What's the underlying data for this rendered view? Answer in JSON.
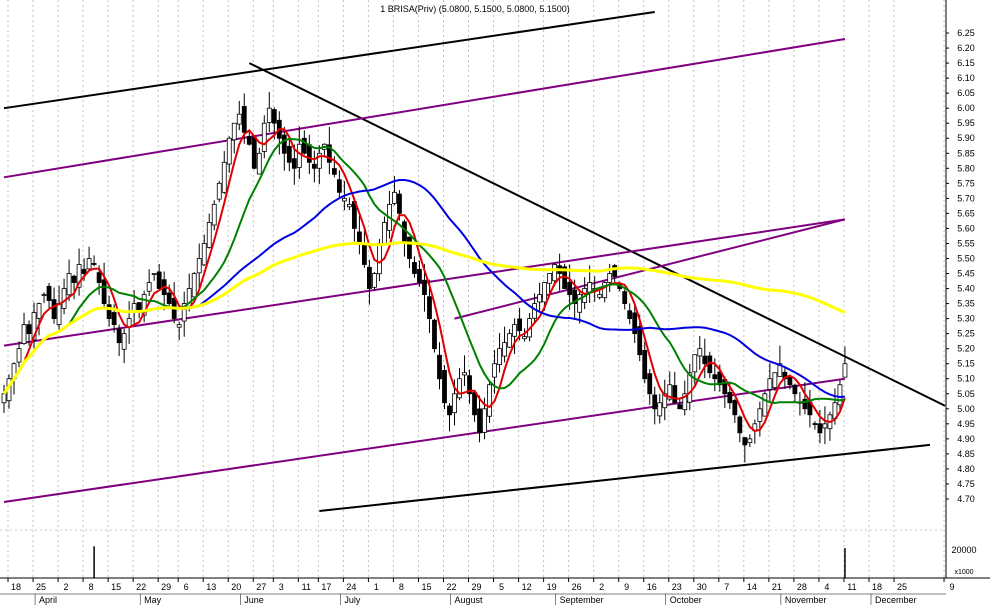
{
  "chart_data": {
    "type": "candlestick",
    "title": "1 BRISA(Priv) (5.0800, 5.1500, 5.0800, 5.1500)",
    "ylim": [
      4.65,
      6.3
    ],
    "y_ticks": [
      "6.25",
      "6.20",
      "6.15",
      "6.10",
      "6.05",
      "6.00",
      "5.95",
      "5.90",
      "5.85",
      "5.80",
      "5.75",
      "5.70",
      "5.65",
      "5.60",
      "5.55",
      "5.50",
      "5.45",
      "5.40",
      "5.35",
      "5.30",
      "5.25",
      "5.20",
      "5.15",
      "5.10",
      "5.05",
      "5.00",
      "4.95",
      "4.90",
      "4.85",
      "4.80",
      "4.75",
      "4.70"
    ],
    "volume_ticks": [
      "20000",
      "x1000"
    ],
    "x_ticks": [
      {
        "label": "18",
        "i": 0
      },
      {
        "label": "25",
        "i": 5
      },
      {
        "label": "2",
        "i": 10
      },
      {
        "label": "8",
        "i": 15
      },
      {
        "label": "15",
        "i": 20
      },
      {
        "label": "22",
        "i": 25
      },
      {
        "label": "29",
        "i": 30
      },
      {
        "label": "6",
        "i": 34
      },
      {
        "label": "13",
        "i": 39
      },
      {
        "label": "20",
        "i": 44
      },
      {
        "label": "27",
        "i": 49
      },
      {
        "label": "3",
        "i": 53
      },
      {
        "label": "11",
        "i": 58
      },
      {
        "label": "17",
        "i": 62
      },
      {
        "label": "24",
        "i": 67
      },
      {
        "label": "1",
        "i": 72
      },
      {
        "label": "8",
        "i": 77
      },
      {
        "label": "15",
        "i": 82
      },
      {
        "label": "22",
        "i": 87
      },
      {
        "label": "29",
        "i": 92
      },
      {
        "label": "5",
        "i": 97
      },
      {
        "label": "12",
        "i": 102
      },
      {
        "label": "19",
        "i": 107
      },
      {
        "label": "26",
        "i": 112
      },
      {
        "label": "2",
        "i": 117
      },
      {
        "label": "9",
        "i": 122
      },
      {
        "label": "16",
        "i": 127
      },
      {
        "label": "23",
        "i": 132
      },
      {
        "label": "30",
        "i": 137
      },
      {
        "label": "7",
        "i": 142
      },
      {
        "label": "14",
        "i": 147
      },
      {
        "label": "21",
        "i": 152
      },
      {
        "label": "28",
        "i": 157
      },
      {
        "label": "4",
        "i": 162
      },
      {
        "label": "11",
        "i": 167
      },
      {
        "label": "18",
        "i": 172
      },
      {
        "label": "25",
        "i": 177
      },
      {
        "label": "9",
        "i": 187
      }
    ],
    "months": [
      {
        "label": "April",
        "i": 11
      },
      {
        "label": "May",
        "i": 32
      },
      {
        "label": "June",
        "i": 52
      },
      {
        "label": "July",
        "i": 72
      },
      {
        "label": "August",
        "i": 94
      },
      {
        "label": "September",
        "i": 115
      },
      {
        "label": "October",
        "i": 137
      },
      {
        "label": "November",
        "i": 160
      },
      {
        "label": "December",
        "i": 178
      }
    ],
    "n_bars": 178,
    "closes": [
      5.05,
      5.1,
      5.15,
      5.2,
      5.28,
      5.25,
      5.32,
      5.35,
      5.38,
      5.36,
      5.3,
      5.35,
      5.4,
      5.45,
      5.42,
      5.48,
      5.45,
      5.5,
      5.48,
      5.42,
      5.35,
      5.3,
      5.28,
      5.22,
      5.25,
      5.3,
      5.35,
      5.32,
      5.38,
      5.42,
      5.45,
      5.4,
      5.38,
      5.35,
      5.3,
      5.28,
      5.35,
      5.4,
      5.45,
      5.5,
      5.55,
      5.62,
      5.68,
      5.75,
      5.82,
      5.9,
      5.95,
      5.98,
      5.92,
      5.88,
      5.8,
      5.85,
      5.95,
      6.0,
      5.95,
      5.9,
      5.85,
      5.82,
      5.8,
      5.88,
      5.85,
      5.82,
      5.8,
      5.85,
      5.88,
      5.82,
      5.78,
      5.72,
      5.7,
      5.68,
      5.6,
      5.55,
      5.48,
      5.4,
      5.45,
      5.55,
      5.62,
      5.68,
      5.72,
      5.65,
      5.55,
      5.5,
      5.45,
      5.42,
      5.38,
      5.3,
      5.2,
      5.1,
      5.02,
      4.98,
      5.05,
      5.1,
      5.12,
      5.05,
      4.98,
      4.92,
      5.0,
      5.08,
      5.15,
      5.2,
      5.22,
      5.25,
      5.28,
      5.26,
      5.24,
      5.3,
      5.35,
      5.38,
      5.42,
      5.45,
      5.48,
      5.45,
      5.4,
      5.38,
      5.35,
      5.38,
      5.4,
      5.42,
      5.4,
      5.38,
      5.42,
      5.45,
      5.44,
      5.4,
      5.35,
      5.3,
      5.25,
      5.18,
      5.1,
      5.05,
      5.0,
      5.02,
      5.05,
      5.08,
      5.02,
      5.0,
      5.05,
      5.12,
      5.18,
      5.2,
      5.15,
      5.12,
      5.1,
      5.08,
      5.05,
      5.02,
      4.98,
      4.92,
      4.88,
      4.9,
      4.95,
      5.0,
      5.05,
      5.1,
      5.12,
      5.15,
      5.1,
      5.08,
      5.05,
      5.02,
      5.0,
      4.98,
      4.95,
      4.92,
      4.95,
      4.98,
      5.02,
      5.08,
      5.15
    ],
    "indicators": [
      {
        "color": "#e00000",
        "period": 5
      },
      {
        "color": "#008000",
        "period": 14
      },
      {
        "color": "#0000e0",
        "period": 40
      },
      {
        "color": "#ffff00",
        "period": 120
      }
    ],
    "trendlines": [
      {
        "color": "#000000",
        "from": [
          0,
          6.0
        ],
        "to": [
          130,
          6.32
        ]
      },
      {
        "color": "#000000",
        "from": [
          49,
          6.15
        ],
        "to": [
          178,
          5.01
        ]
      },
      {
        "color": "#800080",
        "from": [
          0,
          5.77
        ],
        "to": [
          168,
          6.23
        ]
      },
      {
        "color": "#800080",
        "from": [
          0,
          5.21
        ],
        "to": [
          168,
          5.63
        ]
      },
      {
        "color": "#800080",
        "from": [
          0,
          4.69
        ],
        "to": [
          168,
          5.1
        ]
      },
      {
        "color": "#800080",
        "from": [
          90,
          5.3
        ],
        "to": [
          168,
          5.63
        ]
      },
      {
        "color": "#000000",
        "from": [
          63,
          4.66
        ],
        "to": [
          175,
          4.88
        ]
      }
    ],
    "volume_spikes": [
      {
        "i": 18,
        "v": 18000
      },
      {
        "i": 168,
        "v": 17000
      }
    ]
  }
}
